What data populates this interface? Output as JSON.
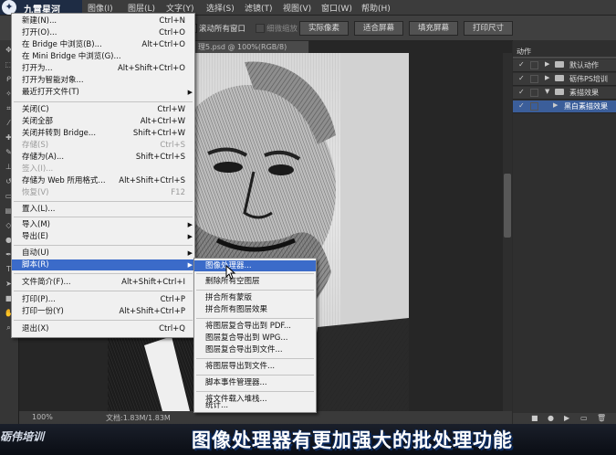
{
  "app": {
    "logo_text": "九霄星河"
  },
  "menubar": {
    "items": [
      "图像(I)",
      "图层(L)",
      "文字(Y)",
      "选择(S)",
      "滤镜(T)",
      "视图(V)",
      "窗口(W)",
      "帮助(H)"
    ]
  },
  "options": {
    "scroll_all_label": "滚动所有窗口",
    "scrubby_zoom_label": "细微缩放",
    "actual_pixels": "实际像素",
    "fit_screen": "适合屏幕",
    "fill_screen": "填充屏幕",
    "print_size": "打印尺寸"
  },
  "document": {
    "tab_title": "理5.psd @ 100%(RGB/8)",
    "zoom": "100%",
    "doc_size": "文档:1.83M/1.83M"
  },
  "file_menu": {
    "new": {
      "label": "新建(N)...",
      "shortcut": "Ctrl+N"
    },
    "open": {
      "label": "打开(O)...",
      "shortcut": "Ctrl+O"
    },
    "browse_bridge": {
      "label": "在 Bridge 中浏览(B)...",
      "shortcut": "Alt+Ctrl+O"
    },
    "browse_mini": {
      "label": "在 Mini Bridge 中浏览(G)..."
    },
    "open_as": {
      "label": "打开为...",
      "shortcut": "Alt+Shift+Ctrl+O"
    },
    "open_smart": {
      "label": "打开为智能对象..."
    },
    "recent": {
      "label": "最近打开文件(T)"
    },
    "close": {
      "label": "关闭(C)",
      "shortcut": "Ctrl+W"
    },
    "close_all": {
      "label": "关闭全部",
      "shortcut": "Alt+Ctrl+W"
    },
    "close_goto": {
      "label": "关闭并转到 Bridge...",
      "shortcut": "Shift+Ctrl+W"
    },
    "save": {
      "label": "存储(S)",
      "shortcut": "Ctrl+S"
    },
    "save_as": {
      "label": "存储为(A)...",
      "shortcut": "Shift+Ctrl+S"
    },
    "checkin": {
      "label": "签入(I)..."
    },
    "save_web": {
      "label": "存储为 Web 所用格式...",
      "shortcut": "Alt+Shift+Ctrl+S"
    },
    "revert": {
      "label": "恢复(V)",
      "shortcut": "F12"
    },
    "place": {
      "label": "置入(L)..."
    },
    "import": {
      "label": "导入(M)"
    },
    "export": {
      "label": "导出(E)"
    },
    "automate": {
      "label": "自动(U)"
    },
    "scripts": {
      "label": "脚本(R)"
    },
    "file_info": {
      "label": "文件简介(F)...",
      "shortcut": "Alt+Shift+Ctrl+I"
    },
    "print": {
      "label": "打印(P)...",
      "shortcut": "Ctrl+P"
    },
    "print_one": {
      "label": "打印一份(Y)",
      "shortcut": "Alt+Shift+Ctrl+P"
    },
    "exit": {
      "label": "退出(X)",
      "shortcut": "Ctrl+Q"
    }
  },
  "scripts_submenu": {
    "image_processor": "图像处理器...",
    "delete_empty": "删除所有空图层",
    "flatten_masks": "拼合所有蒙版",
    "flatten_effects": "拼合所有图层效果",
    "comps_pdf": "将图层复合导出到 PDF...",
    "comps_wpg": "图层复合导出到 WPG...",
    "comps_files": "图层复合导出到文件...",
    "layers_files": "将图层导出到文件...",
    "event_mgr": "脚本事件管理器...",
    "load_stack": "将文件载入堆栈...",
    "stats": "统计..."
  },
  "actions_panel": {
    "title": "动作",
    "items": [
      {
        "label": "默认动作",
        "checked": true
      },
      {
        "label": "砺伟PS培训",
        "checked": true
      },
      {
        "label": "素描效果",
        "checked": true
      },
      {
        "label": "黑白素描效果",
        "checked": true
      }
    ]
  },
  "caption": {
    "brand": "砺伟培训",
    "text": "图像处理器有更加强大的批处理功能"
  },
  "colors": {
    "highlight": "#3b6bc9",
    "menu_bg": "#f0f0f0",
    "ui_dark": "#2b2b2b"
  }
}
